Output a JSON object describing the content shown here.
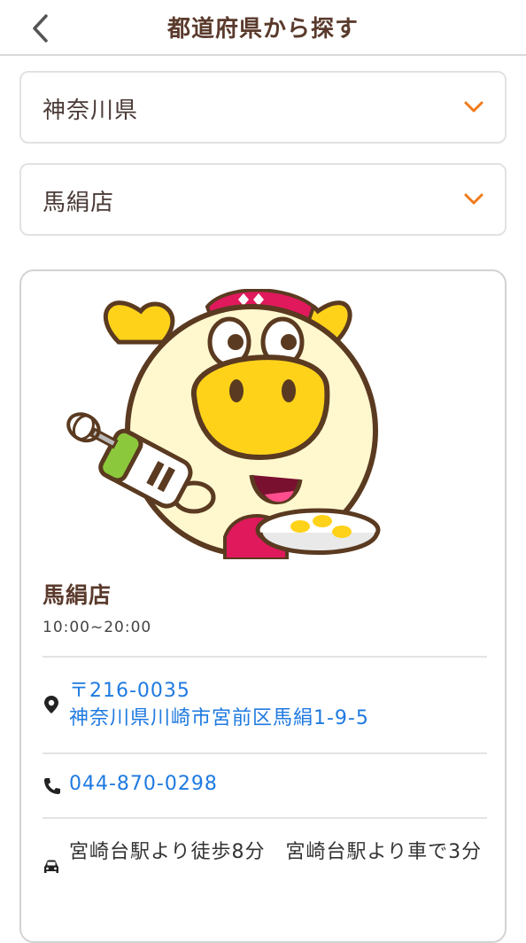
{
  "header": {
    "title": "都道府県から探す",
    "back_icon": "chevron-left-icon"
  },
  "filters": {
    "prefecture": "神奈川県",
    "store": "馬絹店",
    "chevron_color": "#f07a1a"
  },
  "store": {
    "name": "馬絹店",
    "hours": "10:00~20:00",
    "postal_code": "〒216-0035",
    "address": "神奈川県川崎市宮前区馬絹1-9-5",
    "phone": "044-870-0298",
    "access": "宮崎台駅より徒歩8分　宮崎台駅より車で3分",
    "icons": {
      "address": "location-pin-icon",
      "phone": "phone-icon",
      "access": "car-icon"
    }
  },
  "colors": {
    "title": "#5a3a2c",
    "link": "#1f7ae0",
    "accent": "#f07a1a"
  }
}
